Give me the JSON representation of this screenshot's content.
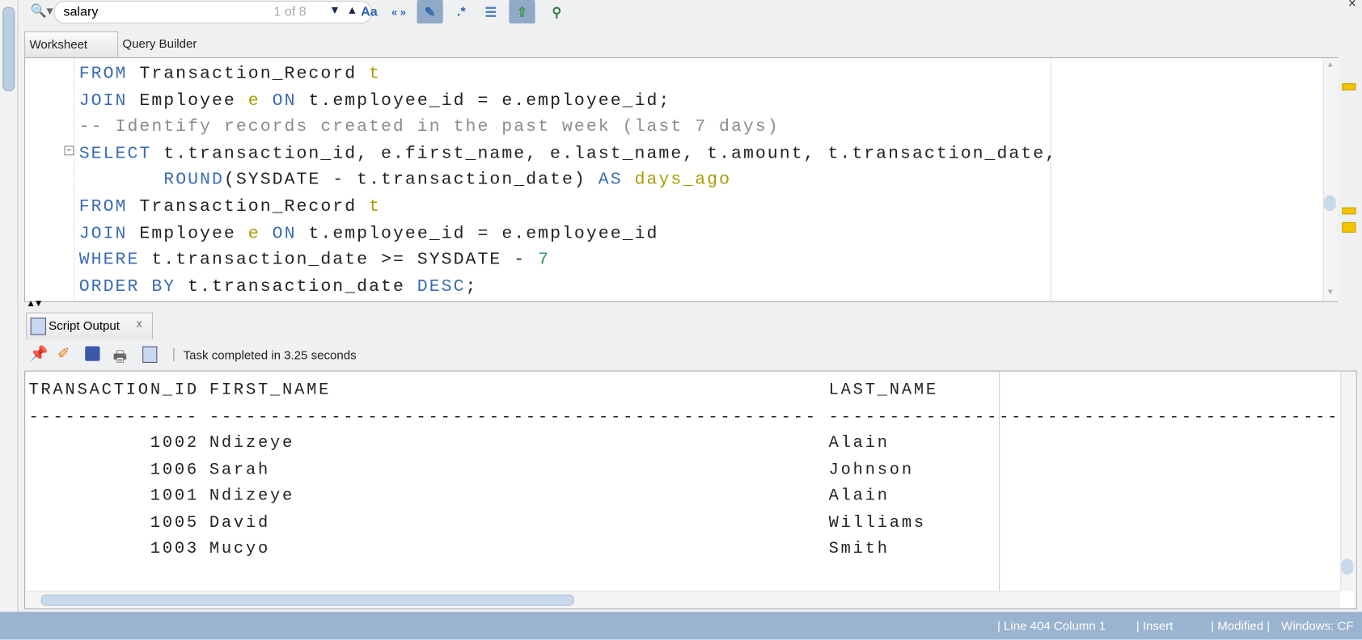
{
  "search": {
    "value": "salary",
    "match_count": "1 of 8"
  },
  "toolbar": {
    "match_case_label": "Aa",
    "whole_word_label": "« »"
  },
  "tabs": [
    {
      "label": "Worksheet"
    },
    {
      "label": "Query Builder"
    }
  ],
  "code_lines": [
    [
      {
        "t": "FROM ",
        "c": "kw"
      },
      {
        "t": "Transaction_Record ",
        "c": "pl"
      },
      {
        "t": "t",
        "c": "al"
      }
    ],
    [
      {
        "t": "JOIN ",
        "c": "kw"
      },
      {
        "t": "Employee ",
        "c": "pl"
      },
      {
        "t": "e ",
        "c": "al"
      },
      {
        "t": "ON ",
        "c": "kw"
      },
      {
        "t": "t.employee_id = e.employee_id;",
        "c": "pl"
      }
    ],
    [
      {
        "t": "-- Identify records created in the past week (last 7 days)",
        "c": "cm"
      }
    ],
    [
      {
        "t": "SELECT ",
        "c": "kw"
      },
      {
        "t": "t.transaction_id, e.first_name, e.last_name, t.amount, t.transaction_date,",
        "c": "pl"
      }
    ],
    [
      {
        "t": "       ",
        "c": "pl"
      },
      {
        "t": "ROUND",
        "c": "kw"
      },
      {
        "t": "(SYSDATE - t.transaction_date) ",
        "c": "pl"
      },
      {
        "t": "AS ",
        "c": "kw"
      },
      {
        "t": "days_ago",
        "c": "al"
      }
    ],
    [
      {
        "t": "FROM ",
        "c": "kw"
      },
      {
        "t": "Transaction_Record ",
        "c": "pl"
      },
      {
        "t": "t",
        "c": "al"
      }
    ],
    [
      {
        "t": "JOIN ",
        "c": "kw"
      },
      {
        "t": "Employee ",
        "c": "pl"
      },
      {
        "t": "e ",
        "c": "al"
      },
      {
        "t": "ON ",
        "c": "kw"
      },
      {
        "t": "t.employee_id = e.employee_id",
        "c": "pl"
      }
    ],
    [
      {
        "t": "WHERE ",
        "c": "kw"
      },
      {
        "t": "t.transaction_date >= SYSDATE - ",
        "c": "pl"
      },
      {
        "t": "7",
        "c": "nm"
      }
    ],
    [
      {
        "t": "ORDER BY ",
        "c": "kw"
      },
      {
        "t": "t.transaction_date ",
        "c": "pl"
      },
      {
        "t": "DESC",
        "c": "kw"
      },
      {
        "t": ";",
        "c": "pl"
      }
    ]
  ],
  "output_tab": {
    "label": "Script Output",
    "close": "x"
  },
  "output_status": "Task completed in 3.25 seconds",
  "results": {
    "headers": [
      "TRANSACTION_ID",
      "FIRST_NAME",
      "LAST_NAME"
    ],
    "separators": [
      "--------------",
      "--------------------------------------------------",
      "------------------------------------------"
    ],
    "rows": [
      [
        "1002",
        "Ndizeye",
        "Alain"
      ],
      [
        "1006",
        "Sarah",
        "Johnson"
      ],
      [
        "1001",
        "Ndizeye",
        "Alain"
      ],
      [
        "1005",
        "David",
        "Williams"
      ],
      [
        "1003",
        "Mucyo",
        "Smith"
      ]
    ]
  },
  "status_bar": {
    "position": "| Line 404 Column 1",
    "mode": "| Insert",
    "modified": "| Modified |",
    "encoding": "Windows: CF"
  }
}
